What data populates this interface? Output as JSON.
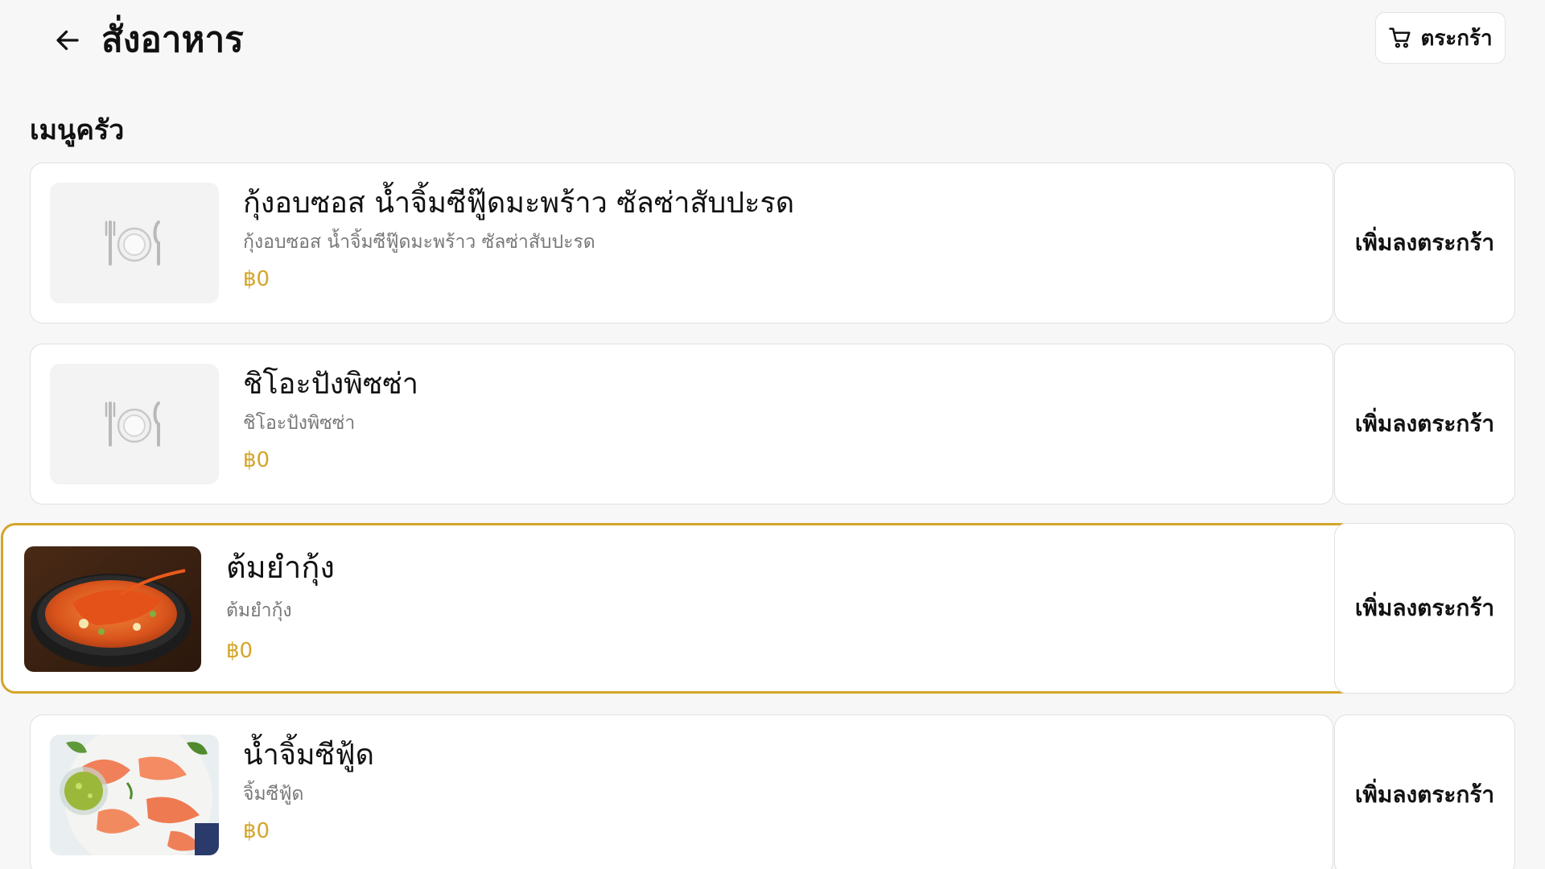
{
  "header": {
    "title": "สั่งอาหาร",
    "back_icon": "arrow-left-icon",
    "cart_label": "ตระกร้า",
    "cart_icon": "cart-icon"
  },
  "section": {
    "title": "เมนูครัว"
  },
  "colors": {
    "accent": "#d4a52a",
    "background": "#f7f7f7",
    "card": "#ffffff",
    "muted_text": "#777777"
  },
  "items": [
    {
      "name": "กุ้งอบซอส น้ำจิ้มซีฟู๊ดมะพร้าว ซัลซ่าสับปะรด",
      "description": "กุ้งอบซอส น้ำจิ้มซีฟู๊ดมะพร้าว ซัลซ่าสับปะรด",
      "price": "฿0",
      "image": "plate-placeholder-icon",
      "add_label": "เพิ่มลงตระกร้า",
      "selected": false
    },
    {
      "name": "ชิโอะปังพิซซ่า",
      "description": "ชิโอะปังพิซซ่า",
      "price": "฿0",
      "image": "plate-placeholder-icon",
      "add_label": "เพิ่มลงตระกร้า",
      "selected": false
    },
    {
      "name": "ต้มยำกุ้ง",
      "description": "ต้มยำกุ้ง",
      "price": "฿0",
      "image": "tom-yum-photo",
      "add_label": "เพิ่มลงตระกร้า",
      "selected": true
    },
    {
      "name": "น้ำจิ้มซีฟู้ด",
      "description": "จิ้มซีฟู้ด",
      "price": "฿0",
      "image": "seafood-dip-photo",
      "add_label": "เพิ่มลงตระกร้า",
      "selected": false
    }
  ]
}
